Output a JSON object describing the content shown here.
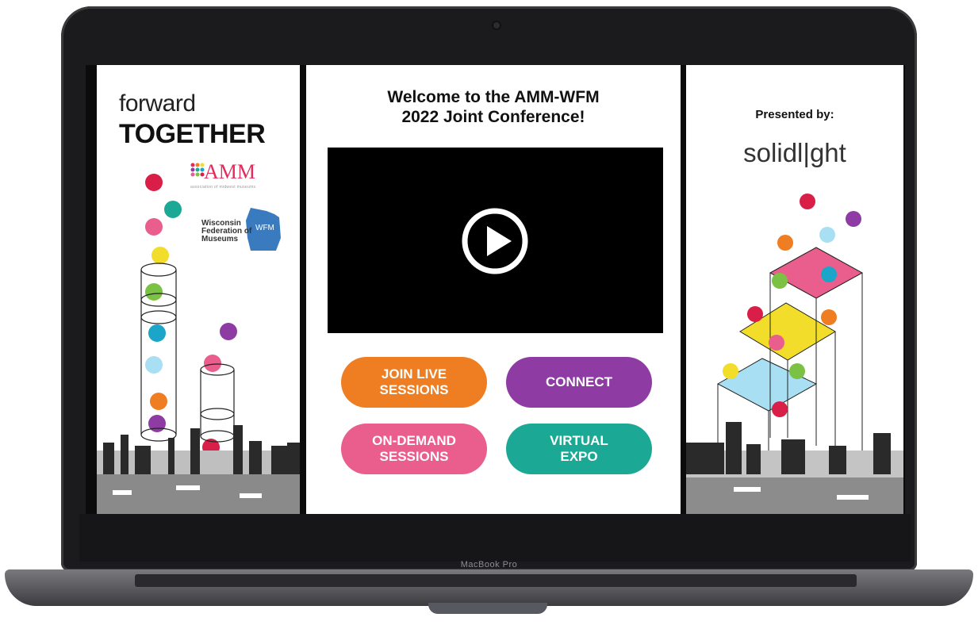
{
  "device": {
    "label": "MacBook Pro"
  },
  "left_panel": {
    "line1": "forward",
    "line2": "TOGETHER",
    "amm_text": "AMM",
    "amm_sub": "association of midwest museums",
    "wfm_badge": "WFM",
    "wfm_text": "Wisconsin Federation of Museums"
  },
  "center": {
    "welcome_line1": "Welcome to the AMM-WFM",
    "welcome_line2": "2022 Joint Conference!",
    "buttons": [
      {
        "label_1": "JOIN LIVE",
        "label_2": "SESSIONS"
      },
      {
        "label_1": "CONNECT",
        "label_2": ""
      },
      {
        "label_1": "ON-DEMAND",
        "label_2": "SESSIONS"
      },
      {
        "label_1": "VIRTUAL",
        "label_2": "EXPO"
      }
    ]
  },
  "right_panel": {
    "presented_by": "Presented by:",
    "sponsor": "solidl|ght"
  },
  "colors": {
    "orange": "#ef7d22",
    "purple": "#8e3ca4",
    "pink": "#e95e8c",
    "teal": "#1ba996",
    "red": "#d91e48",
    "yellow": "#f2dd2a",
    "green": "#7bc143",
    "cyan": "#1ba5c9",
    "sky": "#a9dff2"
  }
}
